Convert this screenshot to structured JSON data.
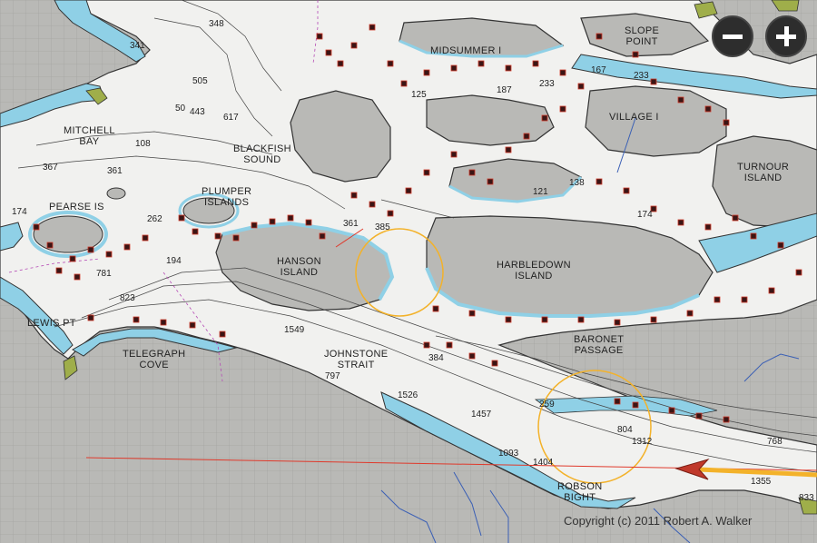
{
  "map": {
    "place_labels": [
      {
        "id": "midsummer",
        "text": "MIDSUMMER I"
      },
      {
        "id": "slope-point",
        "text": "SLOPE\nPOINT"
      },
      {
        "id": "village-i",
        "text": "VILLAGE I"
      },
      {
        "id": "turnour",
        "text": "TURNOUR\nISLAND"
      },
      {
        "id": "mitchell-bay",
        "text": "MITCHELL\nBAY"
      },
      {
        "id": "blackfish",
        "text": "BLACKFISH\nSOUND"
      },
      {
        "id": "plumper",
        "text": "PLUMPER\nISLANDS"
      },
      {
        "id": "pearse",
        "text": "PEARSE IS"
      },
      {
        "id": "hanson",
        "text": "HANSON\nISLAND"
      },
      {
        "id": "harbledown",
        "text": "HARBLEDOWN\nISLAND"
      },
      {
        "id": "lewis-pt",
        "text": "LEWIS PT"
      },
      {
        "id": "telegraph-cove",
        "text": "TELEGRAPH\nCOVE"
      },
      {
        "id": "johnstone",
        "text": "JOHNSTONE\nSTRAIT"
      },
      {
        "id": "baronet",
        "text": "BARONET\nPASSAGE"
      },
      {
        "id": "robson",
        "text": "ROBSON\nBIGHT"
      }
    ],
    "depth_soundings": [
      "348",
      "341",
      "505",
      "50",
      "443",
      "617",
      "125",
      "187",
      "233",
      "167",
      "233",
      "108",
      "367",
      "361",
      "174",
      "262",
      "194",
      "781",
      "823",
      "361",
      "385",
      "121",
      "138",
      "174",
      "1549",
      "797",
      "384",
      "1526",
      "1457",
      "259",
      "804",
      "1312",
      "1093",
      "1404",
      "768",
      "1355",
      "833"
    ],
    "copyright": "Copyright (c) 2011 Robert A. Walker",
    "colors": {
      "land": "#b9b9b6",
      "water": "#f1f1ef",
      "shallow": "#8fd0e6",
      "foreshore": "#9fae4a",
      "track": "#e0392b",
      "route": "#f3b22a"
    }
  },
  "controls": {
    "zoom_out": "minus-icon",
    "zoom_in": "plus-icon"
  }
}
